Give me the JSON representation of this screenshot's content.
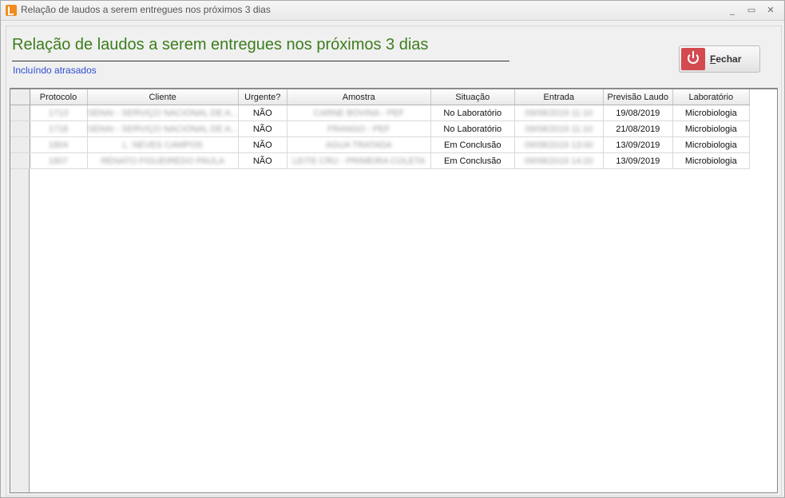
{
  "window": {
    "title": "Relação de laudos a serem entregues nos próximos 3 dias",
    "min_glyph": "_",
    "max_glyph": "▭",
    "close_glyph": "✕"
  },
  "header": {
    "heading": "Relação de laudos a serem entregues nos próximos 3 dias",
    "subtitle": "Incluíndo atrasados"
  },
  "close_button": {
    "accel": "F",
    "rest": "echar",
    "icon": "power-icon",
    "color": "#d34a4f"
  },
  "table": {
    "columns": [
      "Protocolo",
      "Cliente",
      "Urgente?",
      "Amostra",
      "Situação",
      "Entrada",
      "Previsão Laudo",
      "Laboratório"
    ],
    "rows": [
      {
        "protocolo": "1713",
        "cliente": "SENAI - SERVIÇO NACIONAL DE A...",
        "urgente": "NÃO",
        "amostra": "CARNE BOVINA - PEF",
        "situacao": "No Laboratório",
        "entrada": "09/08/2019 11:10",
        "previsao": "19/08/2019",
        "laboratorio": "Microbiologia"
      },
      {
        "protocolo": "1718",
        "cliente": "SENAI - SERVIÇO NACIONAL DE A...",
        "urgente": "NÃO",
        "amostra": "FRANGO - PEF",
        "situacao": "No Laboratório",
        "entrada": "09/08/2019 11:10",
        "previsao": "21/08/2019",
        "laboratorio": "Microbiologia"
      },
      {
        "protocolo": "1804",
        "cliente": "L. NEVES CAMPOS",
        "urgente": "NÃO",
        "amostra": "AGUA TRATADA",
        "situacao": "Em Conclusão",
        "entrada": "09/08/2019 13:00",
        "previsao": "13/09/2019",
        "laboratorio": "Microbiologia"
      },
      {
        "protocolo": "1807",
        "cliente": "RENATO FIGUEIREDO PAULA",
        "urgente": "NÃO",
        "amostra": "LEITE CRU - PRIMEIRA COLETA",
        "situacao": "Em Conclusão",
        "entrada": "09/08/2019 14:20",
        "previsao": "13/09/2019",
        "laboratorio": "Microbiologia"
      }
    ]
  }
}
